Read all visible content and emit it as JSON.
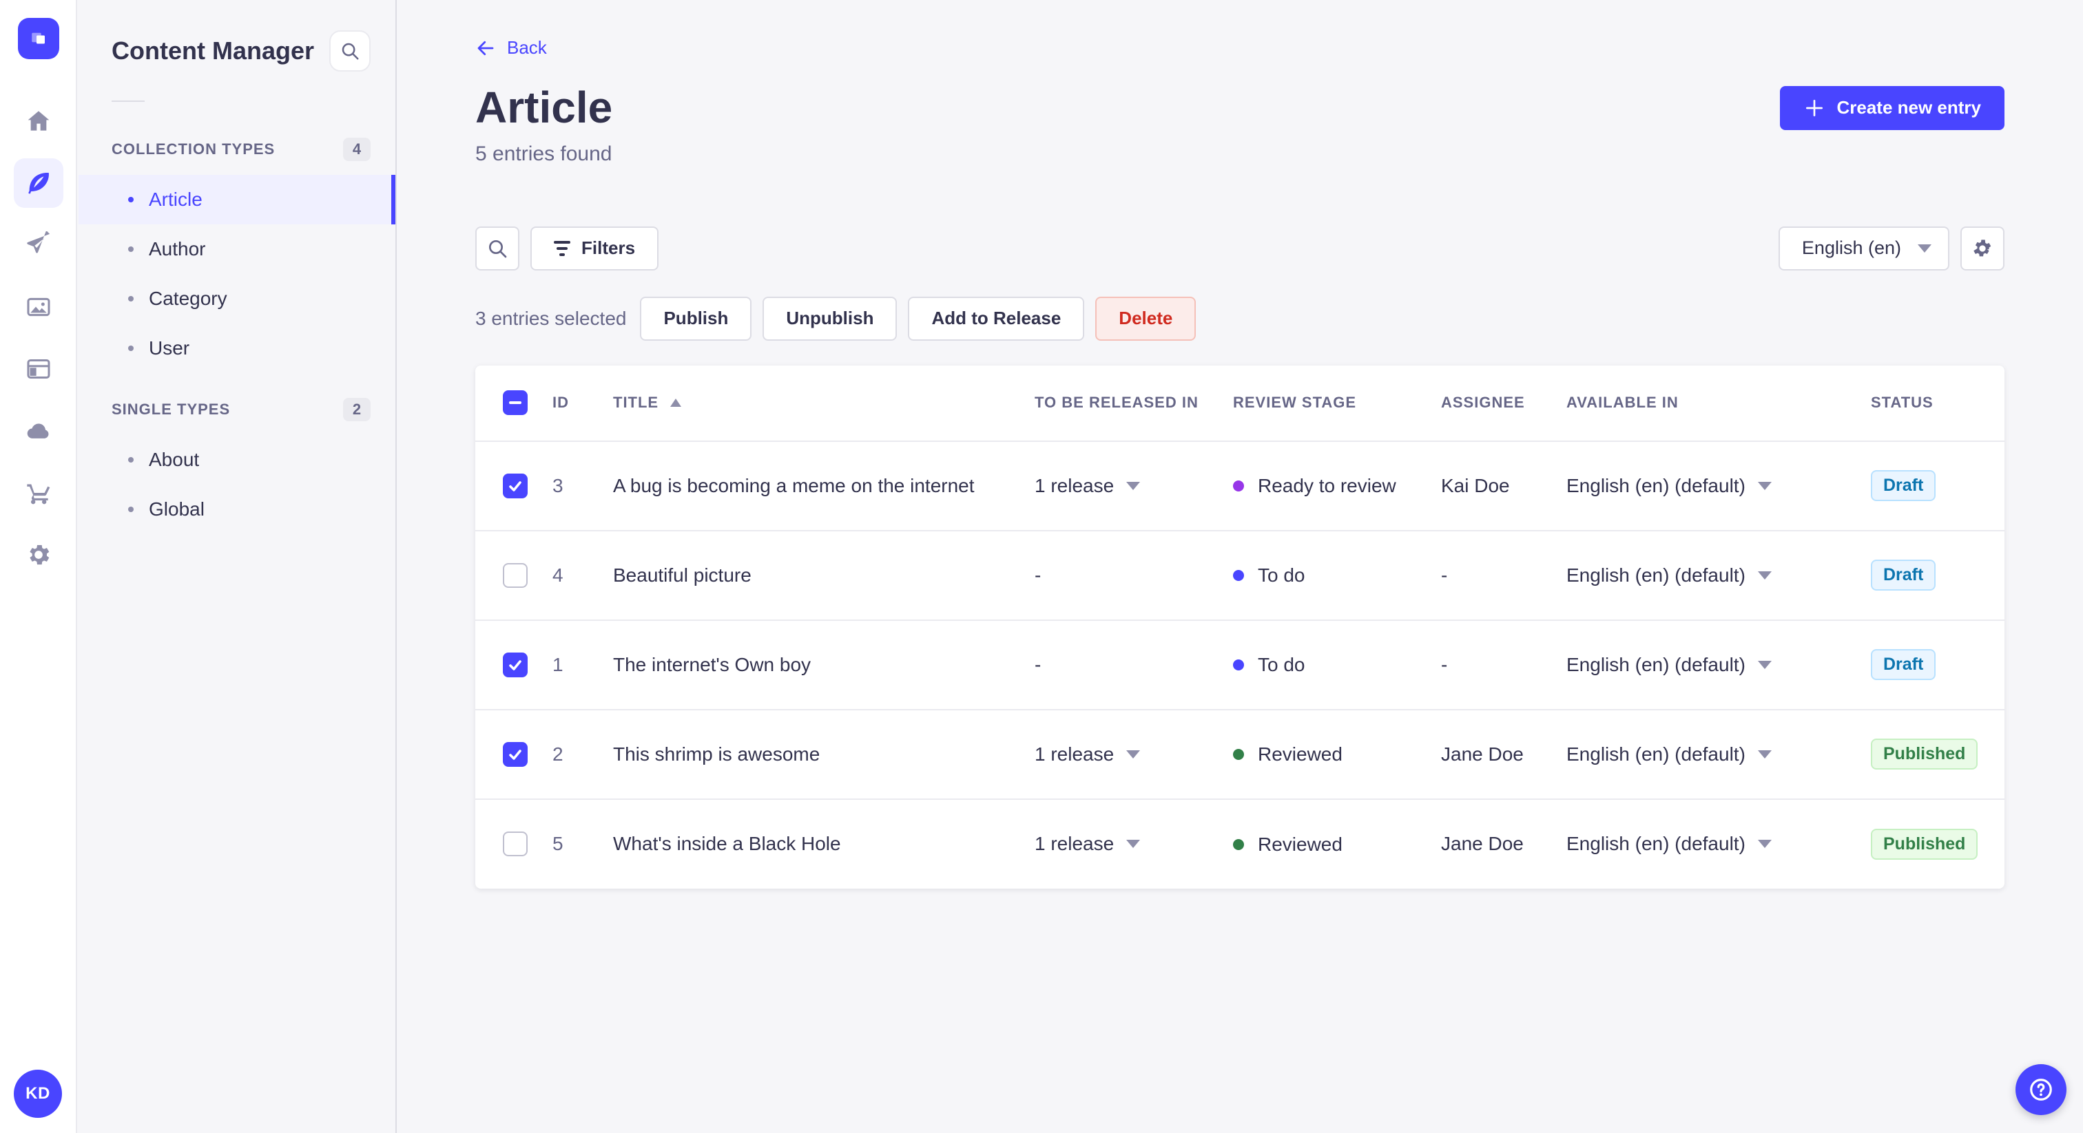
{
  "rail": {
    "logo": "strapi-logo",
    "icons": [
      {
        "name": "home",
        "active": false
      },
      {
        "name": "feather",
        "active": true
      },
      {
        "name": "send",
        "active": false
      },
      {
        "name": "media",
        "active": false
      },
      {
        "name": "layout",
        "active": false
      },
      {
        "name": "cloud",
        "active": false
      },
      {
        "name": "cart",
        "active": false
      },
      {
        "name": "gear",
        "active": false
      }
    ],
    "avatar_initials": "KD"
  },
  "sidebar": {
    "title": "Content Manager",
    "search_icon": "search-icon",
    "sections": [
      {
        "label": "COLLECTION TYPES",
        "count": "4",
        "items": [
          {
            "label": "Article",
            "active": true
          },
          {
            "label": "Author",
            "active": false
          },
          {
            "label": "Category",
            "active": false
          },
          {
            "label": "User",
            "active": false
          }
        ]
      },
      {
        "label": "SINGLE TYPES",
        "count": "2",
        "items": [
          {
            "label": "About",
            "active": false
          },
          {
            "label": "Global",
            "active": false
          }
        ]
      }
    ]
  },
  "header": {
    "back_label": "Back",
    "title": "Article",
    "subtitle": "5 entries found",
    "create_button": "Create new entry"
  },
  "toolbar": {
    "filters_label": "Filters",
    "locale": "English (en)"
  },
  "selection": {
    "text": "3 entries selected",
    "publish": "Publish",
    "unpublish": "Unpublish",
    "add_to_release": "Add to Release",
    "delete": "Delete"
  },
  "table": {
    "headers": [
      "ID",
      "TITLE",
      "TO BE RELEASED IN",
      "REVIEW STAGE",
      "ASSIGNEE",
      "AVAILABLE IN",
      "STATUS"
    ],
    "sorted_by": "TITLE",
    "sort_direction": "asc",
    "rows": [
      {
        "checked": true,
        "id": "3",
        "title": "A bug is becoming a meme on the internet",
        "release": "1 release",
        "release_dropdown": true,
        "stage": "Ready to review",
        "stage_color": "#9736E8",
        "assignee": "Kai Doe",
        "locale": "English (en) (default)",
        "status": "Draft"
      },
      {
        "checked": false,
        "id": "4",
        "title": "Beautiful picture",
        "release": "-",
        "release_dropdown": false,
        "stage": "To do",
        "stage_color": "#4945FF",
        "assignee": "-",
        "locale": "English (en) (default)",
        "status": "Draft"
      },
      {
        "checked": true,
        "id": "1",
        "title": "The internet's Own boy",
        "release": "-",
        "release_dropdown": false,
        "stage": "To do",
        "stage_color": "#4945FF",
        "assignee": "-",
        "locale": "English (en) (default)",
        "status": "Draft"
      },
      {
        "checked": true,
        "id": "2",
        "title": "This shrimp is awesome",
        "release": "1 release",
        "release_dropdown": true,
        "stage": "Reviewed",
        "stage_color": "#328048",
        "assignee": "Jane Doe",
        "locale": "English (en) (default)",
        "status": "Published"
      },
      {
        "checked": false,
        "id": "5",
        "title": "What's inside a Black Hole",
        "release": "1 release",
        "release_dropdown": true,
        "stage": "Reviewed",
        "stage_color": "#328048",
        "assignee": "Jane Doe",
        "locale": "English (en) (default)",
        "status": "Published"
      }
    ]
  },
  "colors": {
    "accent": "#4945FF",
    "danger_text": "#D02B20",
    "danger_bg": "#FCECEA",
    "danger_border": "#F5C0B8",
    "draft_text": "#0C75AF",
    "draft_bg": "#EAF5FF",
    "draft_border": "#B8E1FF",
    "published_text": "#328048",
    "published_bg": "#EAFBE7",
    "published_border": "#C6F0C2"
  },
  "help": {
    "icon": "question-mark-icon"
  }
}
